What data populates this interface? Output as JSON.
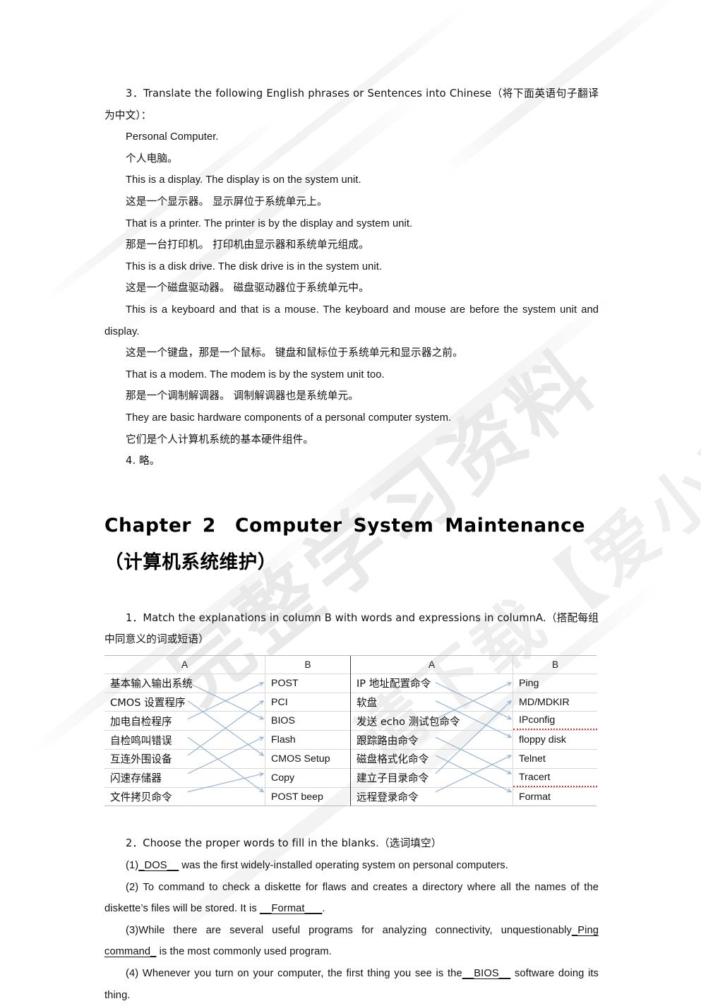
{
  "watermark": {
    "line1": "完整学习资料",
    "line2": "请下载【爱小料】APP"
  },
  "exercise3": {
    "heading": "3．Translate the following English phrases or Sentences into Chinese（将下面英语句子翻译为中文）：",
    "items": [
      "Personal Computer.",
      "个人电脑。",
      "This is a display. The display is on the system unit.",
      "这是一个显示器。 显示屏位于系统单元上。",
      "That is a printer. The printer is by the display and system unit.",
      "那是一台打印机。 打印机由显示器和系统单元组成。",
      "This is a disk drive. The disk drive is in the system unit.",
      "这是一个磁盘驱动器。 磁盘驱动器位于系统单元中。",
      "This is a keyboard and that is a mouse. The keyboard and mouse are before the system unit and display.",
      "这是一个键盘，那是一个鼠标。 键盘和鼠标位于系统单元和显示器之前。",
      "That is a modem. The modem is by the system unit too.",
      "那是一个调制解调器。 调制解调器也是系统单元。",
      "They are basic hardware components of a personal computer system.",
      "它们是个人计算机系统的基本硬件组件。",
      "4. 略。"
    ]
  },
  "chapter": {
    "title": "Chapter 2　Computer System Maintenance（计算机系统维护）"
  },
  "exercise1": {
    "heading": "1．Match the explanations in column B with words and expressions in columnA.（搭配每组中同意义的词或短语）",
    "left_table": {
      "header_a": "A",
      "header_b": "B",
      "column_a": [
        "基本输入输出系统",
        "CMOS 设置程序",
        "加电自检程序",
        "自检鸣叫错误",
        "互连外围设备",
        "闪速存储器",
        "文件拷贝命令"
      ],
      "column_b": [
        "POST",
        "PCI",
        "BIOS",
        "Flash",
        "CMOS Setup",
        "Copy",
        "POST beep"
      ],
      "matches": [
        [
          0,
          2
        ],
        [
          1,
          4
        ],
        [
          2,
          0
        ],
        [
          3,
          6
        ],
        [
          4,
          1
        ],
        [
          5,
          3
        ],
        [
          6,
          5
        ]
      ]
    },
    "right_table": {
      "header_a": "A",
      "header_b": "B",
      "column_a": [
        "IP 地址配置命令",
        "软盘",
        "发送 echo 测试包命令",
        "跟踪路由命令",
        "磁盘格式化命令",
        "建立子目录命令",
        "远程登录命令"
      ],
      "column_b": [
        "Ping",
        "MD/MDKIR",
        "IPconfig",
        "floppy disk",
        "Telnet",
        "Tracert",
        "Format"
      ],
      "matches": [
        [
          0,
          2
        ],
        [
          1,
          3
        ],
        [
          2,
          0
        ],
        [
          3,
          5
        ],
        [
          4,
          6
        ],
        [
          5,
          1
        ],
        [
          6,
          4
        ]
      ]
    }
  },
  "exercise2": {
    "heading": "2．Choose the proper words to fill in the blanks.（选词填空）",
    "q1_pre": "(1)",
    "q1_answer": "_DOS__",
    "q1_post": " was the first widely-installed operating system on personal computers.",
    "q2_pre": "(2) To command to check a diskette for flaws and creates a directory where all the names of the diskette’s files will be stored. It is ",
    "q2_answer": "__Format___",
    "q2_post": ".",
    "q3_pre": "(3)While there are several useful programs for analyzing connectivity, unquestionably",
    "q3_answer": "_Ping command_",
    "q3_post": " is the most commonly used program.",
    "q4_pre": "(4) Whenever you turn on your computer, the first thing you see is the",
    "q4_answer": "__BIOS__",
    "q4_post": " software doing its thing."
  }
}
